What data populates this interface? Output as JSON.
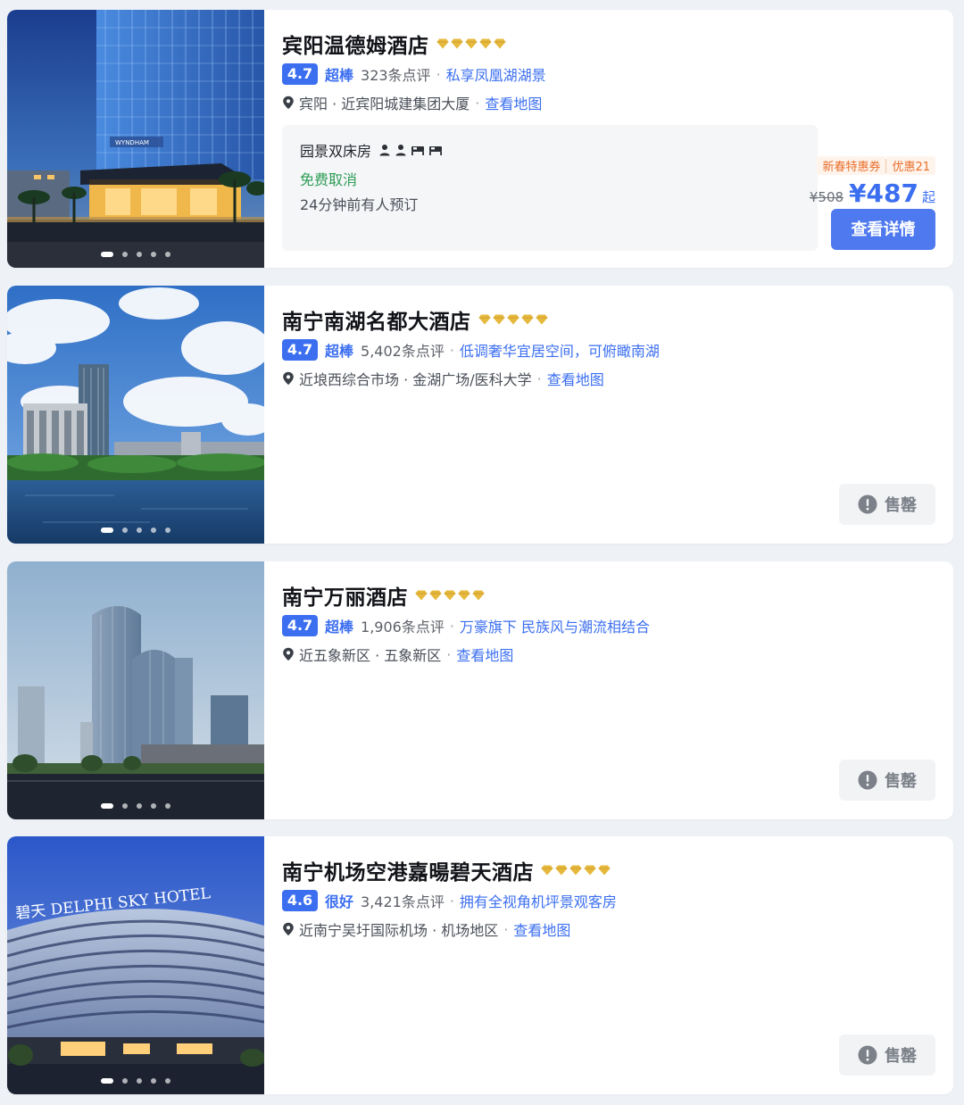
{
  "hotels": [
    {
      "name": "宾阳温德姆酒店",
      "score": "4.7",
      "score_word": "超棒",
      "reviews": "323条点评",
      "tagline": "私享凤凰湖湖景",
      "location": "宾阳 · 近宾阳城建集团大厦",
      "map_link": "查看地图",
      "room_name": "园景双床房",
      "cancel": "免费取消",
      "booked": "24分钟前有人预订",
      "coupon1": "新春特惠券",
      "coupon2": "优惠21",
      "orig_price": "¥508",
      "price": "¥487",
      "price_suffix": "起",
      "button": "查看详情",
      "image_text": "WYNDHAM"
    },
    {
      "name": "南宁南湖名都大酒店",
      "score": "4.7",
      "score_word": "超棒",
      "reviews": "5,402条点评",
      "tagline": "低调奢华宜居空间，可俯瞰南湖",
      "location": "近埌西综合市场 · 金湖广场/医科大学",
      "map_link": "查看地图",
      "soldout": "售罄"
    },
    {
      "name": "南宁万丽酒店",
      "score": "4.7",
      "score_word": "超棒",
      "reviews": "1,906条点评",
      "tagline": "万豪旗下 民族风与潮流相结合",
      "location": "近五象新区 · 五象新区",
      "map_link": "查看地图",
      "soldout": "售罄"
    },
    {
      "name": "南宁机场空港嘉暘碧天酒店",
      "score": "4.6",
      "score_word": "很好",
      "reviews": "3,421条点评",
      "tagline": "拥有全视角机坪景观客房",
      "location": "近南宁吴圩国际机场 · 机场地区",
      "map_link": "查看地图",
      "soldout": "售罄",
      "image_text": "碧天 DELPHI SKY HOTEL"
    }
  ],
  "colors": {
    "accent": "#3c6ff0",
    "gold": "#e0b63c",
    "green": "#2e9d57",
    "coupon": "#e86d2a"
  }
}
